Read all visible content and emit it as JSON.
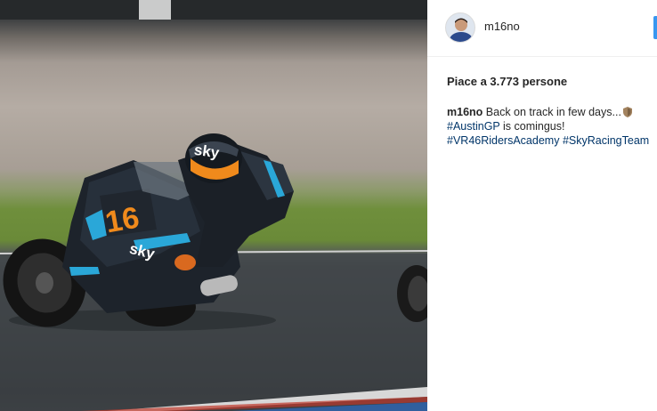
{
  "post": {
    "username": "m16no",
    "likes_text": "Piace a 3.773 persone",
    "caption": {
      "author": "m16no",
      "text_line1": "Back on track in few days...",
      "emoji_icon": "shield-icon",
      "hashtag1": "#AustinGP",
      "text_line2": " is comingus!",
      "hashtag2": "#VR46RidersAcademy",
      "hashtag3": "#SkyRacingTeam"
    }
  },
  "photo": {
    "rider_number": "16",
    "sponsor": "sky",
    "helmet_text": "sky"
  },
  "colors": {
    "accent_blue": "#3897f0",
    "hashtag": "#003569",
    "number_orange": "#f08a1c",
    "bike_cyan": "#2aa7d8"
  }
}
